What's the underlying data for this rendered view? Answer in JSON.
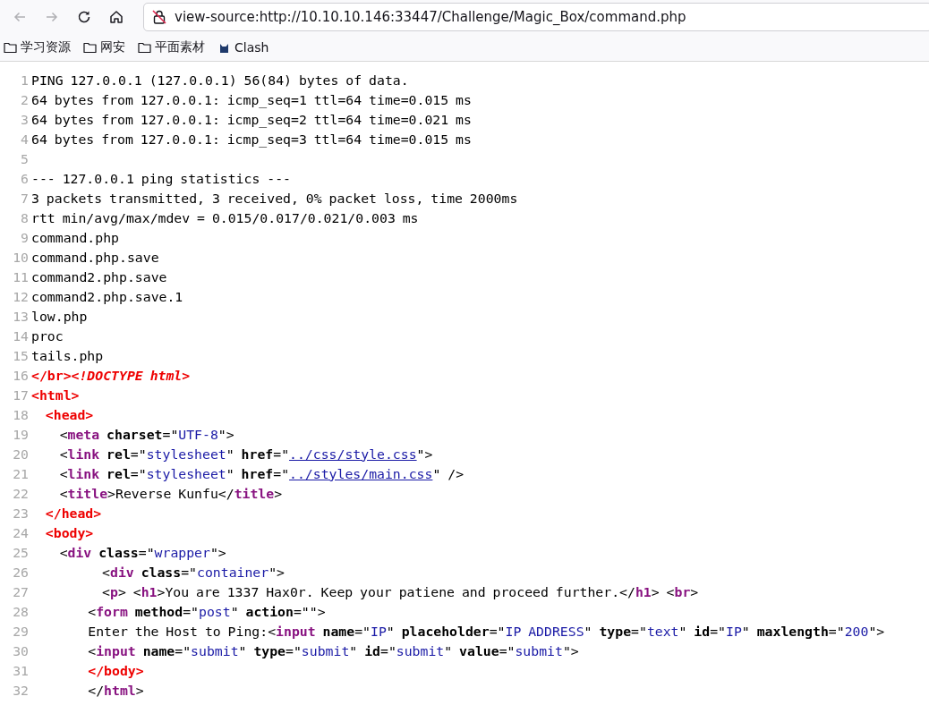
{
  "toolbar": {
    "back": {
      "disabled": true
    },
    "forward": {
      "disabled": true
    },
    "url": "view-source:http://10.10.10.146:33447/Challenge/Magic_Box/command.php"
  },
  "bookmarks": [
    {
      "kind": "folder",
      "label": "学习资源"
    },
    {
      "kind": "folder",
      "label": "网安"
    },
    {
      "kind": "folder",
      "label": "平面素材"
    },
    {
      "kind": "site",
      "label": "Clash"
    }
  ],
  "source": {
    "lines": [
      {
        "number": "1",
        "tokens": [
          {
            "kind": "text",
            "text": "PING 127.0.0.1 (127.0.0.1) 56(84) bytes of data."
          }
        ]
      },
      {
        "number": "2",
        "tokens": [
          {
            "kind": "text",
            "text": "64 bytes from 127.0.0.1: icmp_seq=1 ttl=64 time=0.015 ms"
          }
        ]
      },
      {
        "number": "3",
        "tokens": [
          {
            "kind": "text",
            "text": "64 bytes from 127.0.0.1: icmp_seq=2 ttl=64 time=0.021 ms"
          }
        ]
      },
      {
        "number": "4",
        "tokens": [
          {
            "kind": "text",
            "text": "64 bytes from 127.0.0.1: icmp_seq=3 ttl=64 time=0.015 ms"
          }
        ]
      },
      {
        "number": "5"
      },
      {
        "number": "6",
        "tokens": [
          {
            "kind": "text",
            "text": "--- 127.0.0.1 ping statistics ---"
          }
        ]
      },
      {
        "number": "7",
        "tokens": [
          {
            "kind": "text",
            "text": "3 packets transmitted, 3 received, 0% packet loss, time 2000ms"
          }
        ]
      },
      {
        "number": "8",
        "tokens": [
          {
            "kind": "text",
            "text": "rtt min/avg/max/mdev = 0.015/0.017/0.021/0.003 ms"
          }
        ]
      },
      {
        "number": "9",
        "tokens": [
          {
            "kind": "text",
            "text": "command.php"
          }
        ]
      },
      {
        "number": "10",
        "tokens": [
          {
            "kind": "text",
            "text": "command.php.save"
          }
        ]
      },
      {
        "number": "11",
        "tokens": [
          {
            "kind": "text",
            "text": "command2.php.save"
          }
        ]
      },
      {
        "number": "12",
        "tokens": [
          {
            "kind": "text",
            "text": "command2.php.save.1"
          }
        ]
      },
      {
        "number": "13",
        "tokens": [
          {
            "kind": "text",
            "text": "low.php"
          }
        ]
      },
      {
        "number": "14",
        "tokens": [
          {
            "kind": "text",
            "text": "proc"
          }
        ]
      },
      {
        "number": "15",
        "tokens": [
          {
            "kind": "text",
            "text": "tails.php"
          }
        ]
      },
      {
        "number": "16",
        "tokens": [
          {
            "kind": "error",
            "text": "</br>"
          },
          {
            "kind": "doctype",
            "text": "<!DOCTYPE html>"
          }
        ]
      },
      {
        "number": "17",
        "tokens": [
          {
            "kind": "error",
            "text": "<html>"
          }
        ]
      },
      {
        "number": "18",
        "tokens": [
          {
            "kind": "error",
            "text": "  <head>"
          }
        ]
      },
      {
        "number": "19",
        "tokens": [
          {
            "kind": "text",
            "text": "    <"
          },
          {
            "kind": "tag",
            "text": "meta"
          },
          {
            "kind": "attr",
            "text": " charset"
          },
          {
            "kind": "text",
            "text": "=\""
          },
          {
            "kind": "value",
            "text": "UTF-8"
          },
          {
            "kind": "text",
            "text": "\">"
          }
        ]
      },
      {
        "number": "20",
        "tokens": [
          {
            "kind": "text",
            "text": "    <"
          },
          {
            "kind": "tag",
            "text": "link"
          },
          {
            "kind": "attr",
            "text": " rel"
          },
          {
            "kind": "text",
            "text": "=\""
          },
          {
            "kind": "value",
            "text": "stylesheet"
          },
          {
            "kind": "text",
            "text": "\" "
          },
          {
            "kind": "attr",
            "text": "href"
          },
          {
            "kind": "text",
            "text": "=\""
          },
          {
            "kind": "link",
            "text": "../css/style.css"
          },
          {
            "kind": "text",
            "text": "\">"
          }
        ]
      },
      {
        "number": "21",
        "tokens": [
          {
            "kind": "text",
            "text": "    <"
          },
          {
            "kind": "tag",
            "text": "link"
          },
          {
            "kind": "attr",
            "text": " rel"
          },
          {
            "kind": "text",
            "text": "=\""
          },
          {
            "kind": "value",
            "text": "stylesheet"
          },
          {
            "kind": "text",
            "text": "\" "
          },
          {
            "kind": "attr",
            "text": "href"
          },
          {
            "kind": "text",
            "text": "=\""
          },
          {
            "kind": "link",
            "text": "../styles/main.css"
          },
          {
            "kind": "text",
            "text": "\" />"
          }
        ]
      },
      {
        "number": "22",
        "tokens": [
          {
            "kind": "text",
            "text": "    <"
          },
          {
            "kind": "tag",
            "text": "title"
          },
          {
            "kind": "text",
            "text": ">Reverse Kunfu</"
          },
          {
            "kind": "tag",
            "text": "title"
          },
          {
            "kind": "text",
            "text": ">"
          }
        ]
      },
      {
        "number": "23",
        "tokens": [
          {
            "kind": "error",
            "text": "  </head>"
          }
        ]
      },
      {
        "number": "24",
        "tokens": [
          {
            "kind": "error",
            "text": "  <body>"
          }
        ]
      },
      {
        "number": "25",
        "tokens": [
          {
            "kind": "text",
            "text": "    <"
          },
          {
            "kind": "tag",
            "text": "div"
          },
          {
            "kind": "attr",
            "text": " class"
          },
          {
            "kind": "text",
            "text": "=\""
          },
          {
            "kind": "value",
            "text": "wrapper"
          },
          {
            "kind": "text",
            "text": "\">"
          }
        ]
      },
      {
        "number": "26",
        "tokens": [
          {
            "kind": "text",
            "text": "          <"
          },
          {
            "kind": "tag",
            "text": "div"
          },
          {
            "kind": "attr",
            "text": " class"
          },
          {
            "kind": "text",
            "text": "=\""
          },
          {
            "kind": "value",
            "text": "container"
          },
          {
            "kind": "text",
            "text": "\">"
          }
        ]
      },
      {
        "number": "27",
        "tokens": [
          {
            "kind": "text",
            "text": "          <"
          },
          {
            "kind": "tag",
            "text": "p"
          },
          {
            "kind": "text",
            "text": "> <"
          },
          {
            "kind": "tag",
            "text": "h1"
          },
          {
            "kind": "text",
            "text": ">You are 1337 Hax0r. Keep your patiene and proceed further.</"
          },
          {
            "kind": "tag",
            "text": "h1"
          },
          {
            "kind": "text",
            "text": "> <"
          },
          {
            "kind": "tag",
            "text": "br"
          },
          {
            "kind": "text",
            "text": ">"
          }
        ]
      },
      {
        "number": "28",
        "tokens": [
          {
            "kind": "text",
            "text": "        <"
          },
          {
            "kind": "tag",
            "text": "form"
          },
          {
            "kind": "attr",
            "text": " method"
          },
          {
            "kind": "text",
            "text": "=\""
          },
          {
            "kind": "value",
            "text": "post"
          },
          {
            "kind": "text",
            "text": "\" "
          },
          {
            "kind": "attr",
            "text": "action"
          },
          {
            "kind": "text",
            "text": "=\"\">"
          }
        ]
      },
      {
        "number": "29",
        "tokens": [
          {
            "kind": "text",
            "text": "        Enter the Host to Ping:<"
          },
          {
            "kind": "tag",
            "text": "input"
          },
          {
            "kind": "attr",
            "text": " name"
          },
          {
            "kind": "text",
            "text": "=\""
          },
          {
            "kind": "value",
            "text": "IP"
          },
          {
            "kind": "text",
            "text": "\" "
          },
          {
            "kind": "attr",
            "text": "placeholder"
          },
          {
            "kind": "text",
            "text": "=\""
          },
          {
            "kind": "value",
            "text": "IP ADDRESS"
          },
          {
            "kind": "text",
            "text": "\" "
          },
          {
            "kind": "attr",
            "text": "type"
          },
          {
            "kind": "text",
            "text": "=\""
          },
          {
            "kind": "value",
            "text": "text"
          },
          {
            "kind": "text",
            "text": "\" "
          },
          {
            "kind": "attr",
            "text": "id"
          },
          {
            "kind": "text",
            "text": "=\""
          },
          {
            "kind": "value",
            "text": "IP"
          },
          {
            "kind": "text",
            "text": "\" "
          },
          {
            "kind": "attr",
            "text": "maxlength"
          },
          {
            "kind": "text",
            "text": "=\""
          },
          {
            "kind": "value",
            "text": "200"
          },
          {
            "kind": "text",
            "text": "\">"
          }
        ]
      },
      {
        "number": "30",
        "tokens": [
          {
            "kind": "text",
            "text": "        <"
          },
          {
            "kind": "tag",
            "text": "input"
          },
          {
            "kind": "attr",
            "text": " name"
          },
          {
            "kind": "text",
            "text": "=\""
          },
          {
            "kind": "value",
            "text": "submit"
          },
          {
            "kind": "text",
            "text": "\" "
          },
          {
            "kind": "attr",
            "text": "type"
          },
          {
            "kind": "text",
            "text": "=\""
          },
          {
            "kind": "value",
            "text": "submit"
          },
          {
            "kind": "text",
            "text": "\" "
          },
          {
            "kind": "attr",
            "text": "id"
          },
          {
            "kind": "text",
            "text": "=\""
          },
          {
            "kind": "value",
            "text": "submit"
          },
          {
            "kind": "text",
            "text": "\" "
          },
          {
            "kind": "attr",
            "text": "value"
          },
          {
            "kind": "text",
            "text": "=\""
          },
          {
            "kind": "value",
            "text": "submit"
          },
          {
            "kind": "text",
            "text": "\">"
          }
        ]
      },
      {
        "number": "31",
        "tokens": [
          {
            "kind": "error",
            "text": "        </body>"
          }
        ]
      },
      {
        "number": "32",
        "tokens": [
          {
            "kind": "text",
            "text": "        </"
          },
          {
            "kind": "tag",
            "text": "html"
          },
          {
            "kind": "text",
            "text": ">"
          }
        ]
      }
    ]
  }
}
